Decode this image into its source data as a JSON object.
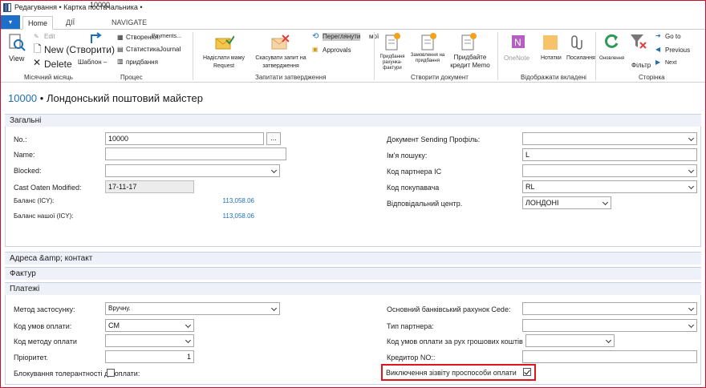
{
  "window": {
    "title": "Редагування • Картка постачальника •",
    "record_no_overlay": "10000"
  },
  "tabs": [
    {
      "label": "Home",
      "active": true
    },
    {
      "label": "ДІЇ",
      "active": false
    },
    {
      "label": "NAVIGATE",
      "active": false
    }
  ],
  "ribbon": {
    "view": "View",
    "edit": "Edit",
    "new": "New (Створити)",
    "delete": "Delete",
    "template": "Шаблон –",
    "create": "Створення",
    "payments": "Payments...",
    "statistics": "Статистика",
    "journal": "Journal",
    "purchases": "придбання",
    "send_approval": "Надіслати маму Request",
    "cancel_approval": "Скасувати запит на затвердження",
    "overview": "Переглянути",
    "overview_tail": "мої",
    "approvals": "Approvals",
    "purchase_invoice": "Придбання рахунка-фактури",
    "purchase_order": "Замовлення на придбання",
    "purchase_credit": "Придбайте кредит Memo",
    "onenote": "OneNote",
    "notes": "Нотатки",
    "links": "Посилання",
    "refresh": "Оновлення",
    "filter": "Фільтр",
    "goto": "Go to",
    "previous": "Previous",
    "next": "Next",
    "group_period": "Місячний місяць",
    "group_process": "Процес",
    "group_approval": "Запитати затвердження",
    "group_create_doc": "Створити документ",
    "group_attachments": "Відображати вкладені",
    "group_page": "Сторінка"
  },
  "page": {
    "number": "10000",
    "name": "• Лондонський поштовий майстер"
  },
  "general": {
    "header": "Загальні",
    "no_label": "No.:",
    "no_value": "10000",
    "name_label": "Name:",
    "name_value": "",
    "blocked_label": "Blocked:",
    "blocked_value": "",
    "last_modified_label": "Cast Oaten Modified:",
    "last_modified_value": "17-11-17",
    "balance_label": "Баланс (ICY):",
    "balance_value": "113,058.06",
    "balance_due_label": "Баланс нашої (ICY):",
    "balance_due_value": "113,058.06",
    "doc_sending_label": "Документ Sending Профіль:",
    "doc_sending_value": "",
    "search_name_label": "Ім'я пошуку:",
    "search_name_value": "L",
    "ic_partner_label": "Код партнера IC",
    "ic_partner_value": "",
    "purchaser_label": "Код покупавача",
    "purchaser_value": "RL",
    "resp_center_label": "Відповідальний центр.",
    "resp_center_value": "ЛОНДОНІ"
  },
  "sections": {
    "address": "Адреса &amp; контакт",
    "invoicing": "Фактур"
  },
  "payments": {
    "header": "Платежі",
    "application_method_label": "Метод застосунку:",
    "application_method_value": "Вручну.",
    "payment_terms_label": "Код умов оплати:",
    "payment_terms_value": "CM",
    "payment_method_label": "Код методу оплати",
    "payment_method_value": "",
    "priority_label": "Пріоритет.",
    "priority_value": "1",
    "block_tolerance_label": "Блокування толерантності до оплати:",
    "block_tolerance_checked": false,
    "preferred_bank_label": "Основний банківський рахунок Cede:",
    "preferred_bank_value": "",
    "partner_type_label": "Тип партнера:",
    "partner_type_value": "",
    "cash_flow_terms_label": "Код умов оплати за рух грошових коштів",
    "cash_flow_terms_value": "",
    "creditor_no_label": "Кредитор NO::",
    "creditor_no_value": "",
    "exclude_label": "Виключення зізвіту проспособи оплати",
    "exclude_checked": true
  }
}
